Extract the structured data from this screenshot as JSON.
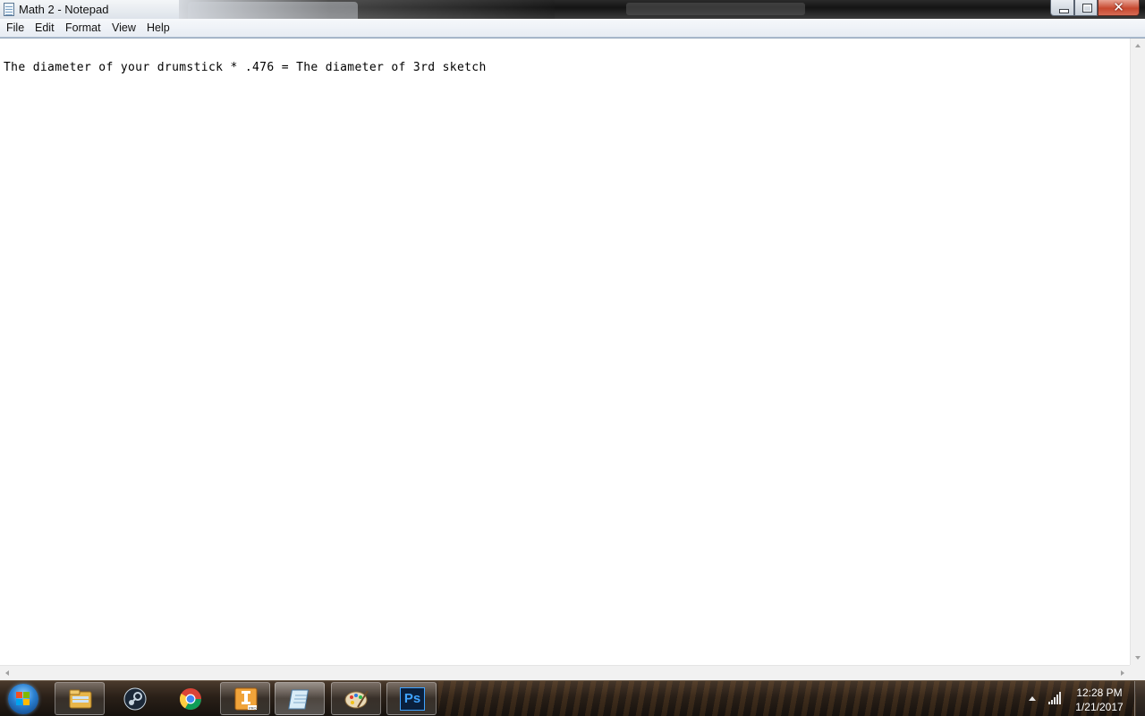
{
  "window": {
    "title": "Math 2 - Notepad"
  },
  "menu": {
    "file": "File",
    "edit": "Edit",
    "format": "Format",
    "view": "View",
    "help": "Help"
  },
  "document": {
    "text": "The diameter of your drumstick * .476 = The diameter of 3rd sketch"
  },
  "taskbar": {
    "pinned": [
      "windows-explorer-icon",
      "steam-icon",
      "chrome-icon",
      "inventor-pro-icon",
      "notepad-icon",
      "paint-icon",
      "photoshop-icon"
    ],
    "photoshop_label": "Ps",
    "clock": {
      "time": "12:28 PM",
      "date": "1/21/2017"
    }
  },
  "colors": {
    "close_button": "#c7482f",
    "menubar_bg": "#f6f8fb",
    "editor_bg": "#ffffff",
    "taskbar_bg": "#2a2018",
    "photoshop_blue": "#0a1f3c"
  }
}
